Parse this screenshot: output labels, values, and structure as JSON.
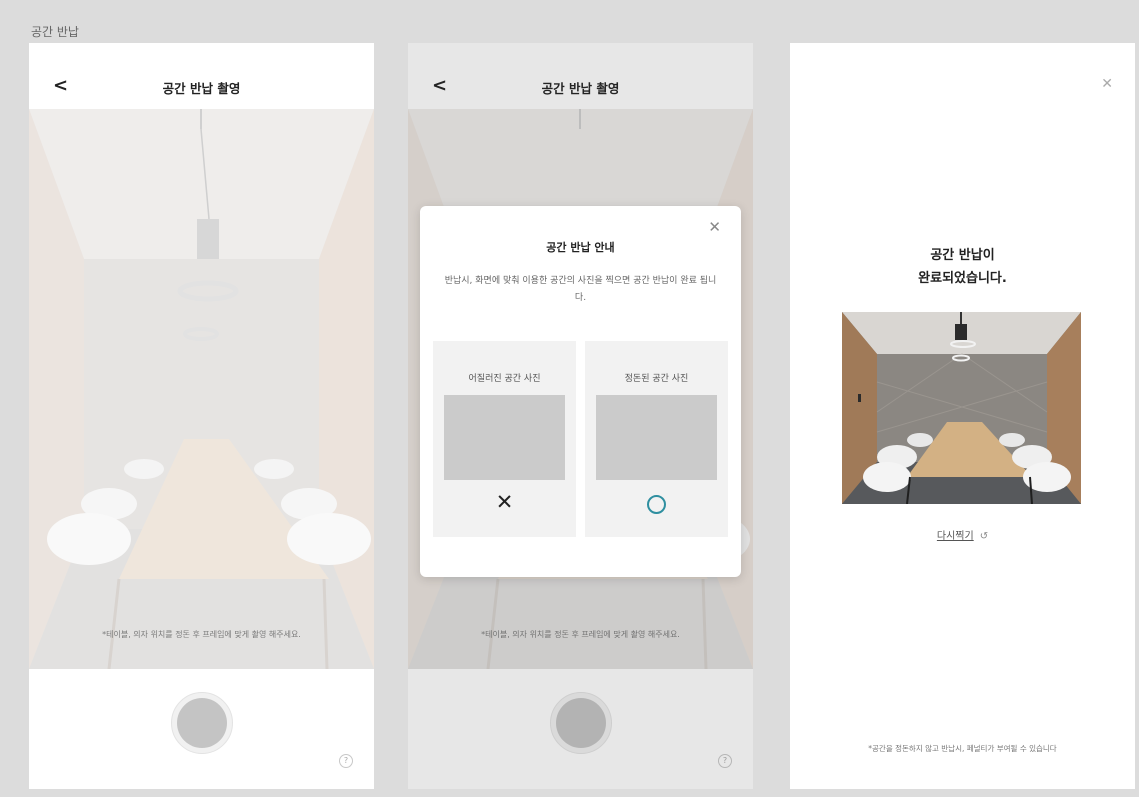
{
  "page": {
    "label": "공간 반납"
  },
  "screen1": {
    "title": "공간 반납 촬영",
    "hint": "*테이블, 의자 위치를 정돈 후 프레임에 맞게 촬영 해주세요.",
    "help": "?"
  },
  "screen2": {
    "title": "공간 반납 촬영",
    "hint": "*테이블, 의자 위치를 정돈 후 프레임에 맞게 촬영 해주세요.",
    "help": "?",
    "modal": {
      "title": "공간 반납 안내",
      "description": "반납시, 화면에 맞춰 이용한 공간의 사진을 찍으면 공간 반납이 완료 됩니다.",
      "bad_card": {
        "label": "어질러진 공간 사진",
        "mark": "✕"
      },
      "good_card": {
        "label": "정돈된 공간 사진",
        "mark": "O"
      }
    }
  },
  "screen3": {
    "title_line1": "공간 반납이",
    "title_line2": "완료되었습니다.",
    "retake": "다시찍기",
    "notice": "*공간을 정돈하지 않고 반납시, 페널티가 부여될 수 있습니다"
  },
  "icons": {
    "back": "chevron-left-icon",
    "close": "close-icon",
    "help": "question-icon",
    "retake": "undo-icon"
  },
  "colors": {
    "accent": "#2f8fa0",
    "background": "#dcdcdc"
  }
}
